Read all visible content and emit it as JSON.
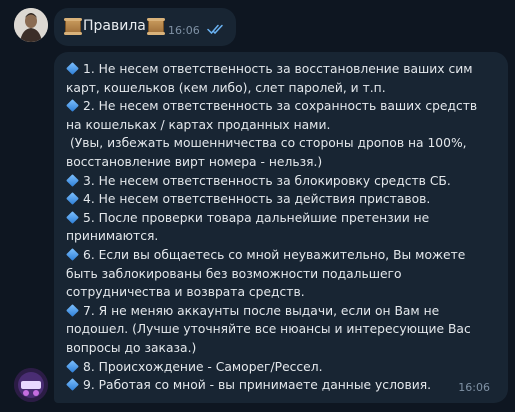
{
  "header_message": {
    "title": "Правила",
    "time": "16:06",
    "status": "read"
  },
  "rules_message": {
    "time": "16:06",
    "lines": [
      {
        "bullet": true,
        "text": "1. Не несем ответственность за восстановление ваших сим"
      },
      {
        "bullet": false,
        "text": "карт, кошельков (кем либо), слет паролей, и т.п."
      },
      {
        "bullet": true,
        "text": "2. Не несем ответственность за сохранность ваших средств"
      },
      {
        "bullet": false,
        "text": "на кошельках / картах проданных нами."
      },
      {
        "bullet": false,
        "indent": true,
        "text": "(Увы, избежать мошенничества со стороны дропов на 100%,"
      },
      {
        "bullet": false,
        "text": "восстановление вирт номера - нельзя.)"
      },
      {
        "bullet": true,
        "text": "3. Не несем ответственность за блокировку средств СБ."
      },
      {
        "bullet": true,
        "text": "4. Не несем ответственность за действия приставов."
      },
      {
        "bullet": true,
        "text": "5. После проверки товара дальнейшие претензии не"
      },
      {
        "bullet": false,
        "text": "принимаются."
      },
      {
        "bullet": true,
        "text": "6. Если вы общаетесь со мной неуважительно, Вы можете"
      },
      {
        "bullet": false,
        "text": "быть заблокированы без возможности подальшего"
      },
      {
        "bullet": false,
        "text": "сотрудничества и возврата средств."
      },
      {
        "bullet": true,
        "text": "7. Я не меняю аккаунты после выдачи, если он Вам не"
      },
      {
        "bullet": false,
        "text": "подошел. (Лучше уточняйте все нюансы и интересующие Вас"
      },
      {
        "bullet": false,
        "text": "вопросы до заказа.)"
      },
      {
        "bullet": true,
        "text": "8. Происхождение - Саморег/Рессел."
      },
      {
        "bullet": true,
        "text": "9. Работая со мной - вы принимаете данные условия."
      }
    ]
  },
  "colors": {
    "background": "#0e1621",
    "bubble": "#182533",
    "text": "#e4e8ec",
    "meta": "#7f91a4",
    "check": "#6ab2f2",
    "bullet": "#4a9be8"
  }
}
